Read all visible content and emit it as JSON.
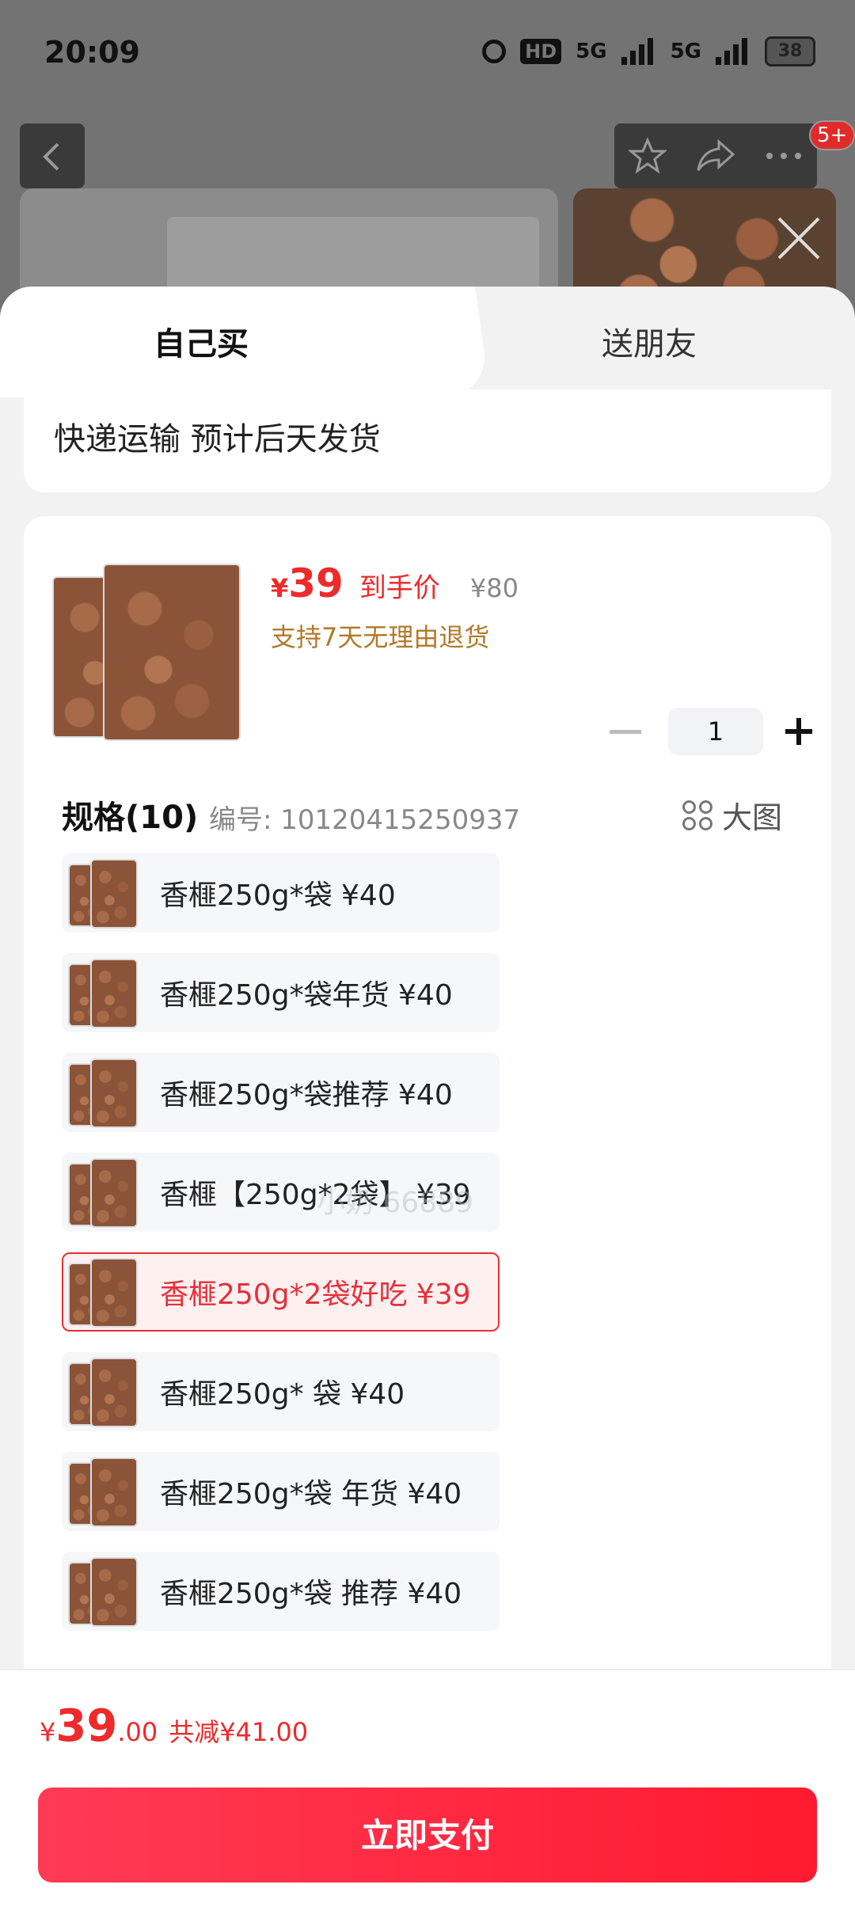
{
  "status_bar": {
    "time": "20:09",
    "hd_label": "HD",
    "network_1": "5G",
    "network_2": "5G",
    "battery": "38"
  },
  "top_bar": {
    "back_icon": "chevron-left-icon",
    "favorite_icon": "star-icon",
    "share_icon": "share-icon",
    "more_icon": "more-icon",
    "message_badge": "5+"
  },
  "tabs": [
    {
      "label": "自己买",
      "active": true
    },
    {
      "label": "送朋友",
      "active": false
    }
  ],
  "delivery": {
    "text": "快递运输 预计后天发货"
  },
  "product": {
    "price_symbol": "¥",
    "price": "39",
    "price_tag": "到手价",
    "original_price": "¥80",
    "refund_note": "支持7天无理由退货",
    "quantity": "1"
  },
  "spec": {
    "title": "规格(10)",
    "code": "编号: 10120415250937",
    "big_picture_label": "大图",
    "options": [
      {
        "label": "香榧250g*袋  ¥40",
        "selected": false
      },
      {
        "label": "香榧250g*袋年货  ¥40",
        "selected": false
      },
      {
        "label": "香榧250g*袋推荐  ¥40",
        "selected": false
      },
      {
        "label": "香榧【250g*2袋】 ¥39",
        "selected": false
      },
      {
        "label": "香榧250g*2袋好吃  ¥39",
        "selected": true
      },
      {
        "label": "香榧250g* 袋  ¥40",
        "selected": false
      },
      {
        "label": "香榧250g*袋 年货  ¥40",
        "selected": false
      },
      {
        "label": "香榧250g*袋 推荐  ¥40",
        "selected": false
      }
    ]
  },
  "watermark": "小奶 66889",
  "footer": {
    "price_symbol": "¥",
    "price_int": "39",
    "price_dec": ".00",
    "savings": "共减¥41.00",
    "pay_label": "立即支付"
  },
  "colors": {
    "accent": "#ee2a2a",
    "refund_note": "#b07a2a",
    "selected_border": "#e5303a"
  }
}
